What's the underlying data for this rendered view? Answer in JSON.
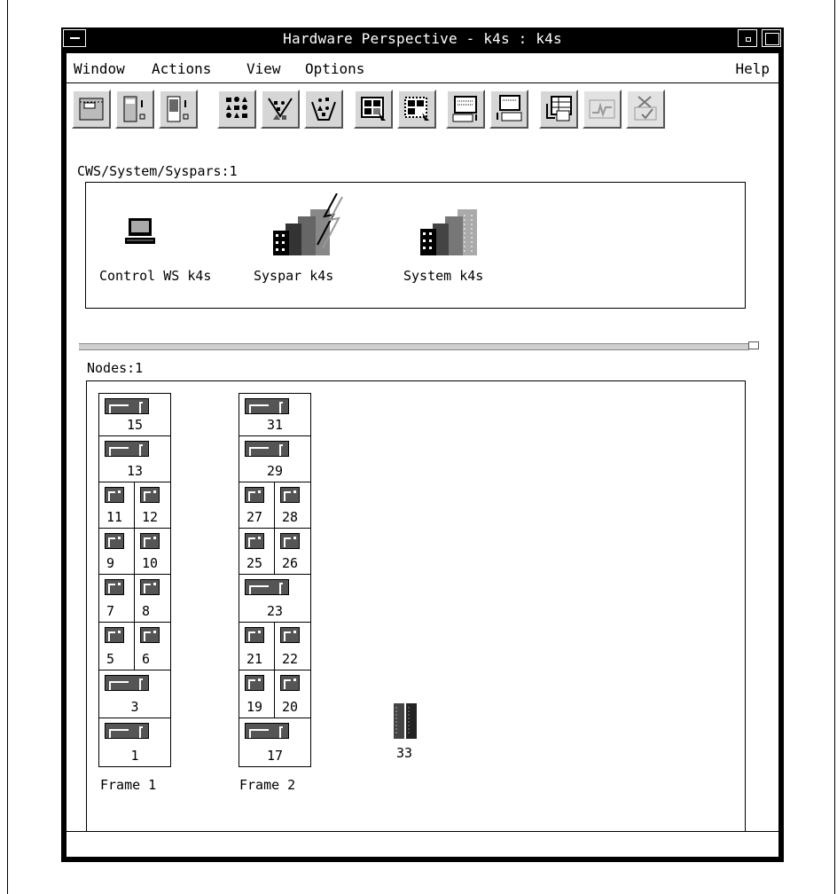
{
  "window": {
    "title": "Hardware Perspective - k4s : k4s"
  },
  "menubar": {
    "window": "Window",
    "actions": "Actions",
    "view": "View",
    "options": "Options",
    "help": "Help"
  },
  "toolbar": {
    "buttons": [
      {
        "icon": "notebook-icon",
        "enabled": true
      },
      {
        "icon": "node-properties-icon",
        "enabled": true
      },
      {
        "icon": "frame-properties-icon",
        "enabled": true
      },
      {
        "icon": "icon-view-icon",
        "enabled": true
      },
      {
        "icon": "filter-icon",
        "enabled": true
      },
      {
        "icon": "filter-all-icon",
        "enabled": true
      },
      {
        "icon": "select-pane-icon",
        "enabled": true
      },
      {
        "icon": "deselect-pane-icon",
        "enabled": true
      },
      {
        "icon": "open-terminal-icon",
        "enabled": true
      },
      {
        "icon": "keyboard-terminal-icon",
        "enabled": true
      },
      {
        "icon": "table-view-icon",
        "enabled": true
      },
      {
        "icon": "monitor-graph-icon",
        "enabled": false
      },
      {
        "icon": "check-icon",
        "enabled": false
      }
    ]
  },
  "top_pane": {
    "label": "CWS/System/Syspars:1",
    "objects": [
      {
        "icon": "workstation-icon",
        "label": "Control WS k4s"
      },
      {
        "icon": "syspar-icon",
        "label": "Syspar k4s"
      },
      {
        "icon": "system-icon",
        "label": "System k4s"
      }
    ]
  },
  "nodes_pane": {
    "label": "Nodes:1",
    "frame1": {
      "label": "Frame 1",
      "slots": [
        "15",
        "13",
        "11",
        "12",
        "9",
        "10",
        "7",
        "8",
        "5",
        "6",
        "3",
        "1"
      ]
    },
    "frame2": {
      "label": "Frame 2",
      "slots": [
        "31",
        "29",
        "27",
        "28",
        "25",
        "26",
        "23",
        "21",
        "22",
        "19",
        "20",
        "17"
      ]
    },
    "standalone": {
      "icon": "server-tower-icon",
      "label": "33"
    }
  }
}
